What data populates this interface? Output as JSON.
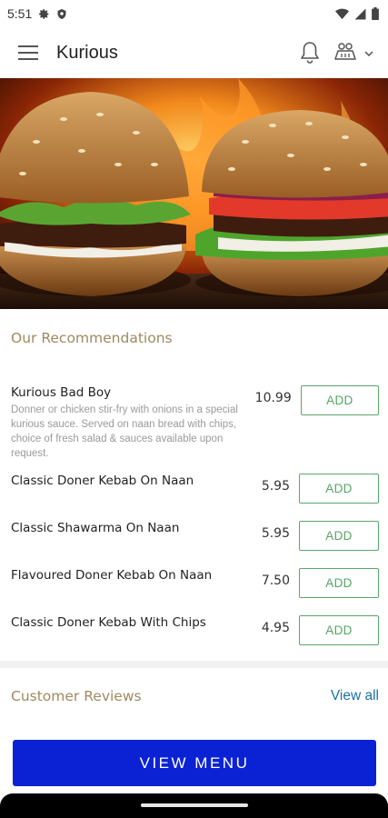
{
  "status_bar": {
    "time": "5:51",
    "icons": [
      "gear-icon",
      "shield-icon",
      "wifi-icon",
      "signal-icon",
      "battery-icon"
    ]
  },
  "app_bar": {
    "title": "Kurious",
    "icons": [
      "hamburger-menu-icon",
      "bell-icon",
      "cart-icon",
      "chevron-down-icon"
    ]
  },
  "hero": {
    "image": "burgers-on-flames"
  },
  "recommendations": {
    "title": "Our Recommendations",
    "items": [
      {
        "name": "Kurious Bad Boy",
        "description": "Donner or chicken stir-fry with onions in a special kurious sauce. Served on naan bread with chips, choice of fresh salad & sauces available upon request.",
        "price": "10.99",
        "button": "ADD"
      },
      {
        "name": "Classic Doner Kebab On Naan",
        "price": "5.95",
        "button": "ADD"
      },
      {
        "name": "Classic Shawarma On Naan",
        "price": "5.95",
        "button": "ADD"
      },
      {
        "name": "Flavoured Doner Kebab On Naan",
        "price": "7.50",
        "button": "ADD"
      },
      {
        "name": "Classic Doner Kebab With Chips",
        "price": "4.95",
        "button": "ADD"
      }
    ]
  },
  "reviews": {
    "title": "Customer Reviews",
    "view_all": "View all"
  },
  "cta": {
    "label": "VIEW MENU"
  },
  "colors": {
    "accent_gold": "#9f8a5f",
    "add_green": "#55a565",
    "link_blue": "#1d6fa8",
    "cta_blue": "#0b22d4"
  }
}
